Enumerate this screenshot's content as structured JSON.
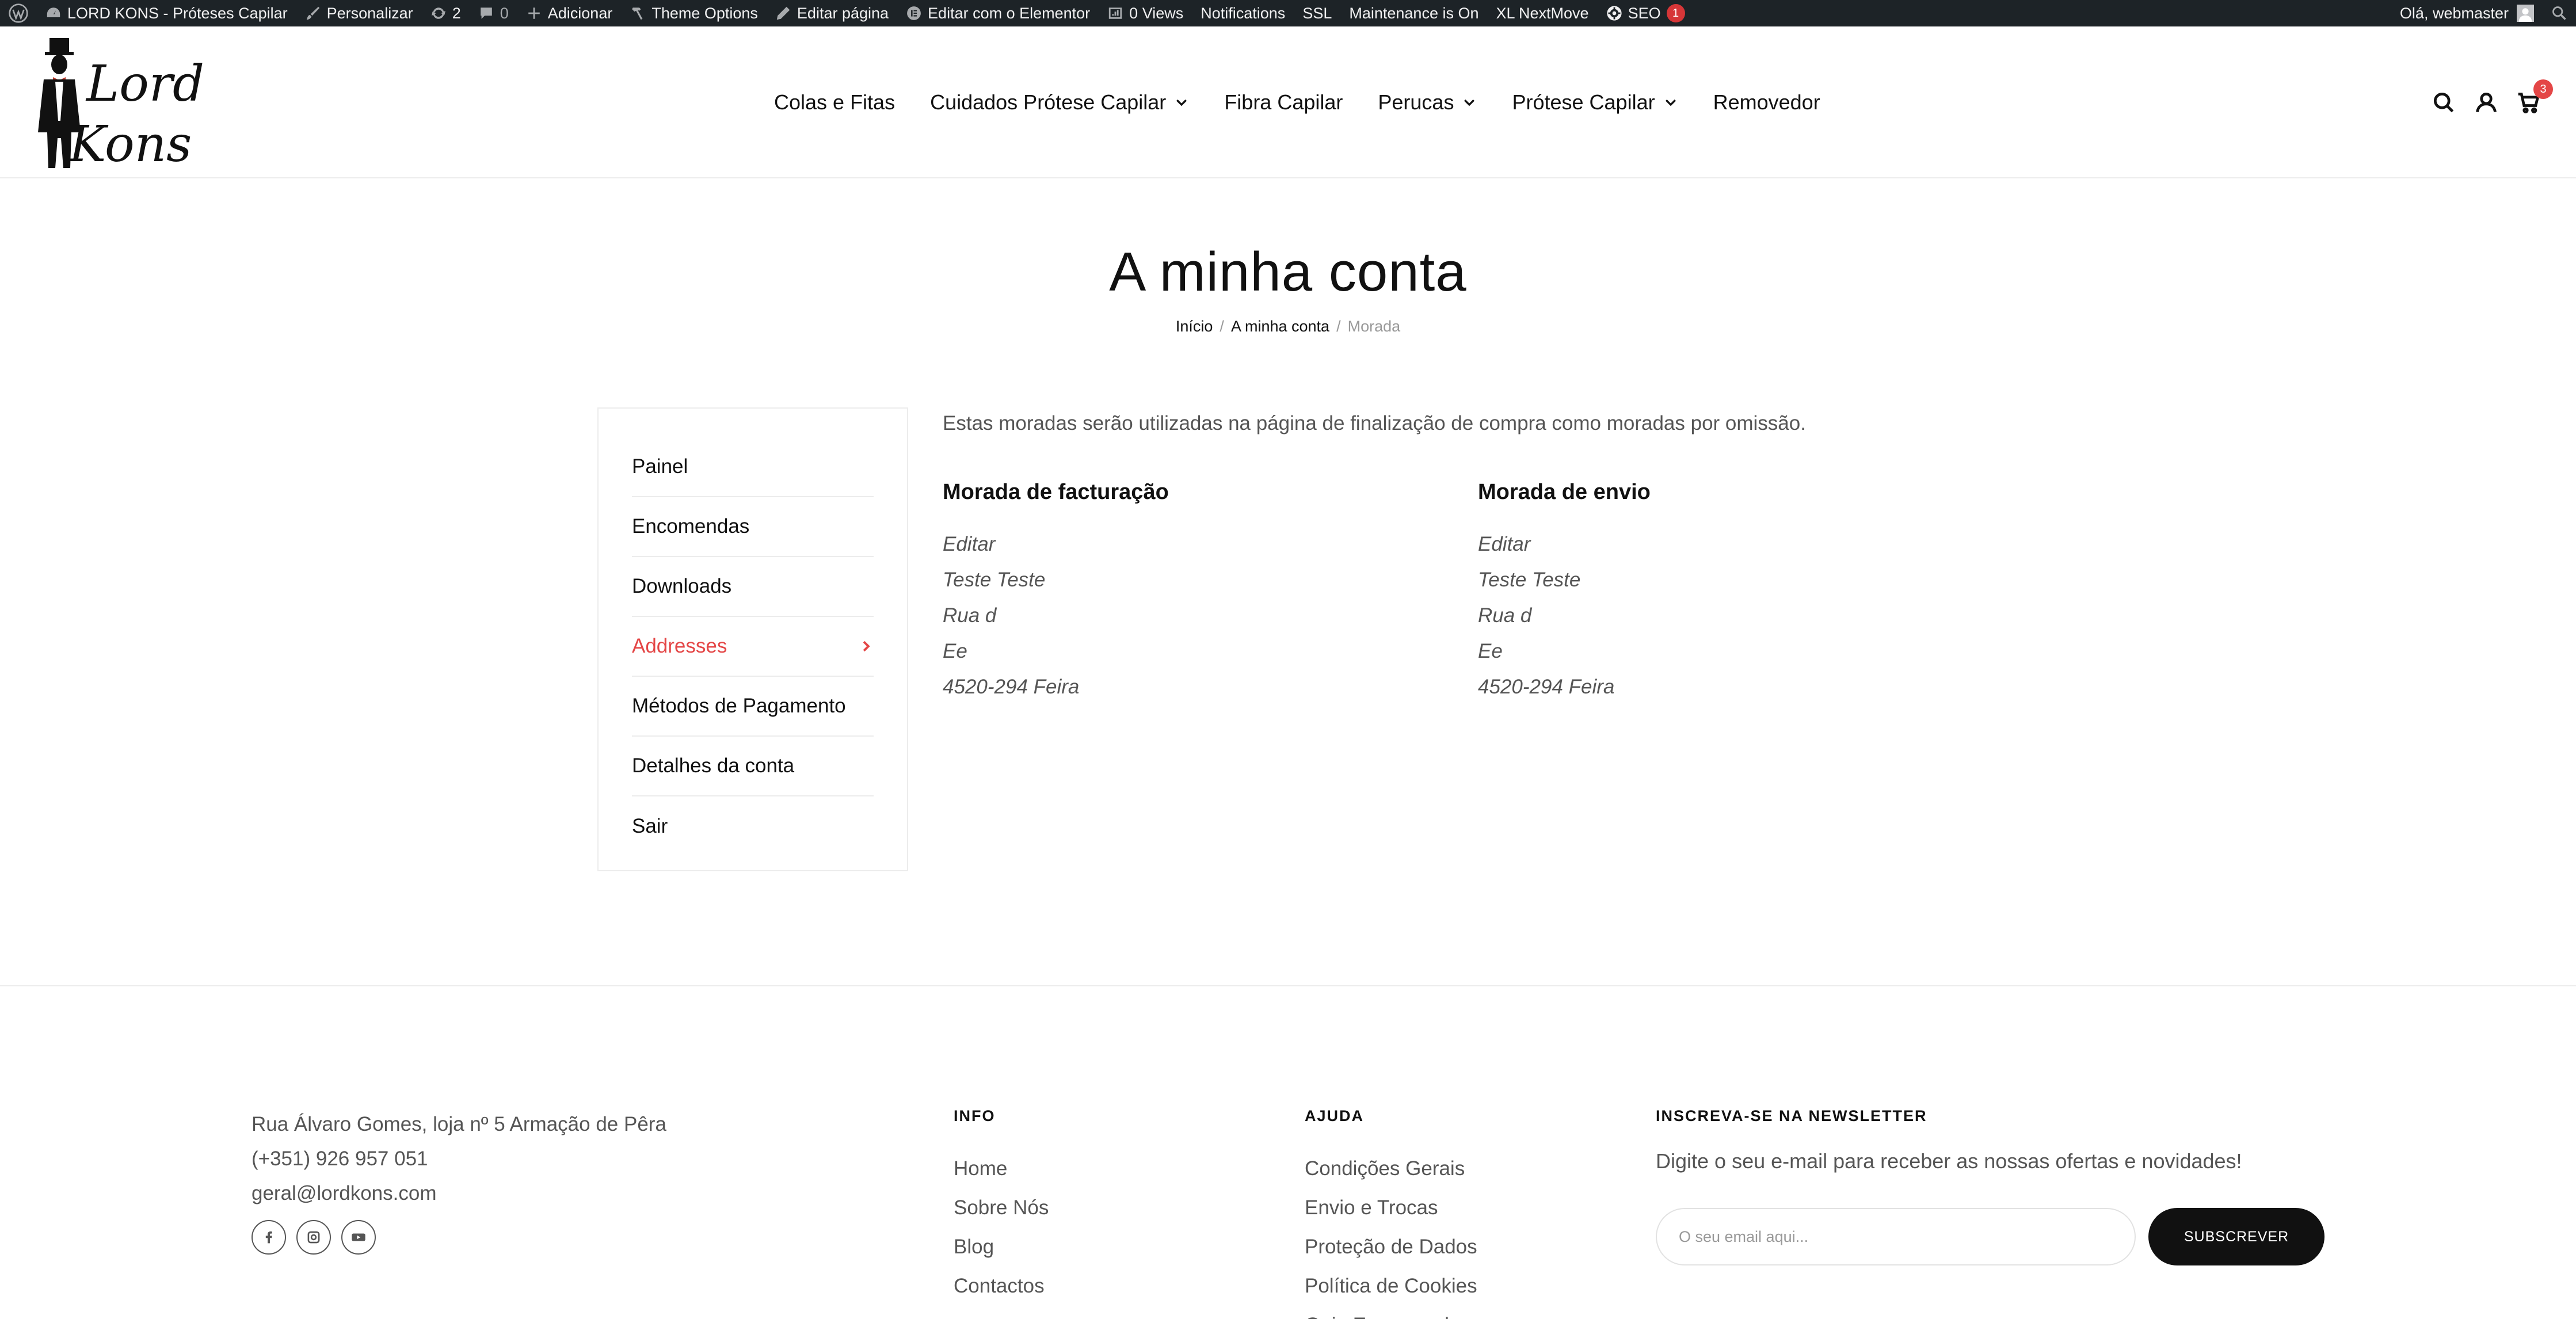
{
  "admin_bar": {
    "site_name": "LORD KONS - Próteses Capilar",
    "customize": "Personalizar",
    "updates_count": "2",
    "comments_count": "0",
    "add_new": "Adicionar",
    "theme_options": "Theme Options",
    "edit_page": "Editar página",
    "edit_elementor": "Editar com o Elementor",
    "views": "0 Views",
    "notifications": "Notifications",
    "ssl": "SSL",
    "maintenance": "Maintenance is On",
    "nextmove": "XL NextMove",
    "seo": "SEO",
    "seo_badge": "1",
    "greeting": "Olá, webmaster"
  },
  "header": {
    "logo_line1": "Lord",
    "logo_line2": "Kons",
    "nav": [
      {
        "label": "Colas e Fitas",
        "has_dropdown": false
      },
      {
        "label": "Cuidados Prótese Capilar",
        "has_dropdown": true
      },
      {
        "label": "Fibra Capilar",
        "has_dropdown": false
      },
      {
        "label": "Perucas",
        "has_dropdown": true
      },
      {
        "label": "Prótese Capilar",
        "has_dropdown": true
      },
      {
        "label": "Removedor",
        "has_dropdown": false
      }
    ],
    "cart_count": "3",
    "icons": [
      "search-icon",
      "user-icon",
      "cart-icon"
    ]
  },
  "page": {
    "title": "A minha conta",
    "breadcrumb": [
      "Início",
      "A minha conta",
      "Morada"
    ]
  },
  "account_nav": [
    {
      "label": "Painel",
      "active": false
    },
    {
      "label": "Encomendas",
      "active": false
    },
    {
      "label": "Downloads",
      "active": false
    },
    {
      "label": "Addresses",
      "active": true
    },
    {
      "label": "Métodos de Pagamento",
      "active": false
    },
    {
      "label": "Detalhes da conta",
      "active": false
    },
    {
      "label": "Sair",
      "active": false
    }
  ],
  "addresses": {
    "intro": "Estas moradas serão utilizadas na página de finalização de compra como moradas por omissão.",
    "billing": {
      "title": "Morada de facturação",
      "edit": "Editar",
      "lines": [
        "Teste Teste",
        "Rua d",
        "Ee",
        "4520-294 Feira"
      ]
    },
    "shipping": {
      "title": "Morada de envio",
      "edit": "Editar",
      "lines": [
        "Teste Teste",
        "Rua d",
        "Ee",
        "4520-294 Feira"
      ]
    }
  },
  "footer": {
    "address": "Rua Álvaro Gomes, loja nº 5 Armação de Pêra",
    "phone": "(+351) 926 957 051",
    "email": "geral@lordkons.com",
    "socials": [
      "facebook-icon",
      "instagram-icon",
      "youtube-icon"
    ],
    "info": {
      "heading": "INFO",
      "links": [
        "Home",
        "Sobre Nós",
        "Blog",
        "Contactos"
      ]
    },
    "help": {
      "heading": "AJUDA",
      "links": [
        "Condições Gerais",
        "Envio e Trocas",
        "Proteção de Dados",
        "Política de Cookies",
        "Guia Encomendas"
      ]
    },
    "newsletter": {
      "heading": "INSCREVA-SE NA NEWSLETTER",
      "text": "Digite o seu e-mail para receber as nossas ofertas e novidades!",
      "placeholder": "O seu email aqui...",
      "button": "SUBSCREVER"
    }
  },
  "colors": {
    "admin_bar_bg": "#1d2327",
    "accent": "#e44646",
    "text": "#111111",
    "muted": "#555555",
    "border": "#ececec"
  }
}
